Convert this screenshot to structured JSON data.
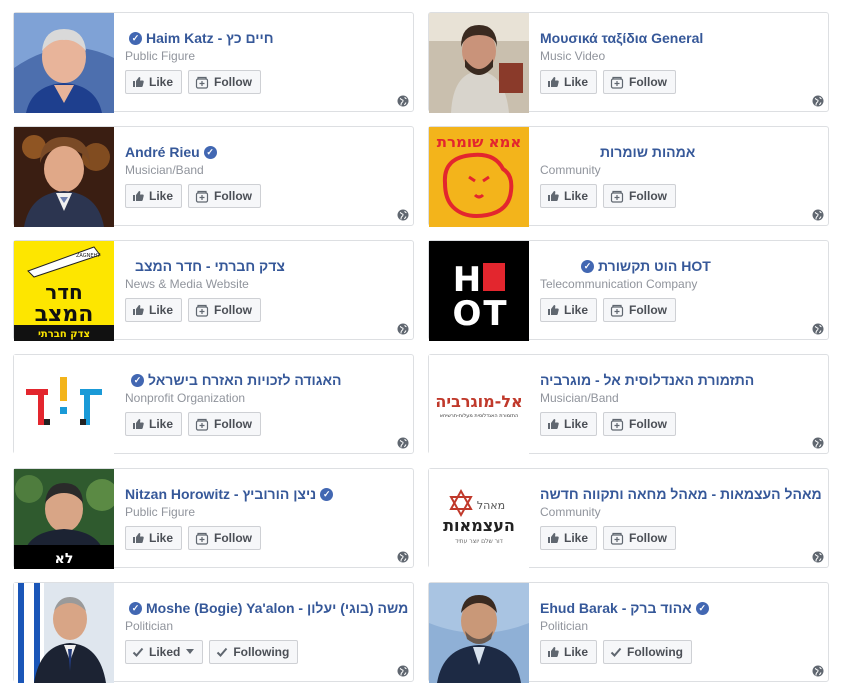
{
  "cards": [
    {
      "name": "Haim Katz - חיים כץ",
      "category": "Public Figure",
      "like": "Like",
      "follow": "Follow",
      "verified": true
    },
    {
      "name": "Μουσικά ταξίδια General",
      "category": "Music Video",
      "like": "Like",
      "follow": "Follow",
      "verified": false
    },
    {
      "name": "André Rieu",
      "category": "Musician/Band",
      "like": "Like",
      "follow": "Follow",
      "verified": true
    },
    {
      "name": "אמהות שומרות",
      "category": "Community",
      "like": "Like",
      "follow": "Follow",
      "verified": false
    },
    {
      "name": "צדק חברתי - חדר המצב",
      "category": "News & Media Website",
      "like": "Like",
      "follow": "Follow",
      "verified": false
    },
    {
      "name": "הוט תקשורת HOT",
      "category": "Telecommunication Company",
      "like": "Like",
      "follow": "Follow",
      "verified": true
    },
    {
      "name": "האגודה לזכויות האזרח בישראל",
      "category": "Nonprofit Organization",
      "like": "Like",
      "follow": "Follow",
      "verified": true
    },
    {
      "name": "התזמורת האנדלוסית אל - מוגרביה",
      "category": "Musician/Band",
      "like": "Like",
      "follow": "Follow",
      "verified": false
    },
    {
      "name": "Nitzan Horowitz - ניצן הורוביץ",
      "category": "Public Figure",
      "like": "Like",
      "follow": "Follow",
      "verified": true
    },
    {
      "name": "מאהל העצמאות - מאהל מחאה ותקווה חדשה",
      "category": "Community",
      "like": "Like",
      "follow": "Follow",
      "verified": false
    },
    {
      "name": "Moshe (Bogie) Ya'alon - משה (בוגי) יעלון",
      "category": "Politician",
      "like": "Liked",
      "follow": "Following",
      "verified": true
    },
    {
      "name": "Ehud Barak - אהוד ברק",
      "category": "Politician",
      "like": "Like",
      "follow": "Following",
      "verified": true
    }
  ],
  "logos": {
    "amot": "אמא שומרת",
    "heder_top": "חדר",
    "heder_bottom": "המצב",
    "heder_sub": "צדק חברתי",
    "heder_tape": "ZAGNEHT",
    "hot_h": "H",
    "hot_o": "O",
    "hot_t": "T",
    "mogrebia": "אל-מוגרביה",
    "mogrebia_sub": "התזמורת האנדלוסית מעלות-תרשיחא",
    "ohel_top": "מאהל",
    "ohel_main": "העצמאות",
    "ohel_sub": "דור שלם יוצר עתיד",
    "meretz": "לא"
  },
  "colors": {
    "link": "#365899",
    "verified": "#4267b2",
    "muted": "#90949c",
    "button_bg": "#f6f7f9",
    "button_border": "#ced0d4",
    "card_border": "#dddfe2"
  },
  "icons": {
    "like": "thumbs-up-icon",
    "liked": "thumbs-up-icon",
    "follow": "follow-plus-icon",
    "following": "checkmark-icon",
    "dropdown": "caret-down-icon",
    "privacy": "globe-icon"
  }
}
